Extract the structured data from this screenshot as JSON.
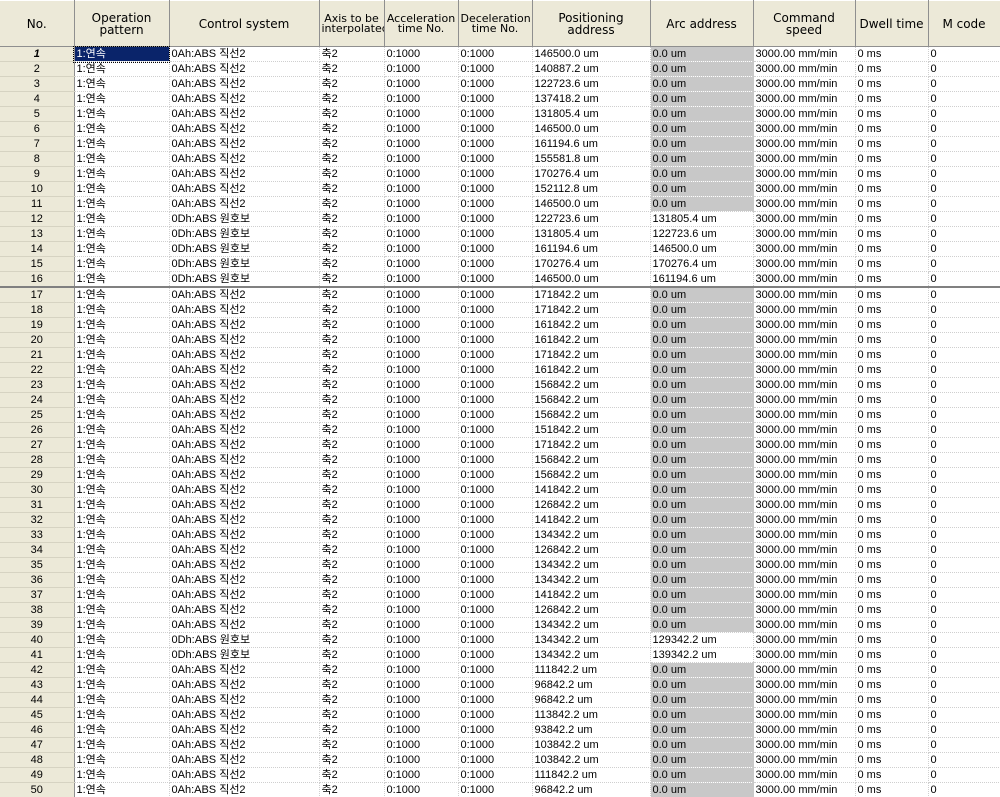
{
  "headers": {
    "no": "No.",
    "pattern": "Operation pattern",
    "control": "Control system",
    "axis": "Axis to be interpolated",
    "accel": "Acceleration time No.",
    "decel": "Deceleration time No.",
    "pos": "Positioning address",
    "arc": "Arc address",
    "speed": "Command speed",
    "dwell": "Dwell time",
    "mcode": "M code"
  },
  "rows": [
    {
      "no": "1",
      "pattern": "1:연속",
      "control": "0Ah:ABS 직선2",
      "axis": "축2",
      "accel": "0:1000",
      "decel": "0:1000",
      "pos": "146500.0 um",
      "arc": "0.0 um",
      "speed": "3000.00 mm/min",
      "dwell": "0 ms",
      "mcode": "0"
    },
    {
      "no": "2",
      "pattern": "1:연속",
      "control": "0Ah:ABS 직선2",
      "axis": "축2",
      "accel": "0:1000",
      "decel": "0:1000",
      "pos": "140887.2 um",
      "arc": "0.0 um",
      "speed": "3000.00 mm/min",
      "dwell": "0 ms",
      "mcode": "0"
    },
    {
      "no": "3",
      "pattern": "1:연속",
      "control": "0Ah:ABS 직선2",
      "axis": "축2",
      "accel": "0:1000",
      "decel": "0:1000",
      "pos": "122723.6 um",
      "arc": "0.0 um",
      "speed": "3000.00 mm/min",
      "dwell": "0 ms",
      "mcode": "0"
    },
    {
      "no": "4",
      "pattern": "1:연속",
      "control": "0Ah:ABS 직선2",
      "axis": "축2",
      "accel": "0:1000",
      "decel": "0:1000",
      "pos": "137418.2 um",
      "arc": "0.0 um",
      "speed": "3000.00 mm/min",
      "dwell": "0 ms",
      "mcode": "0"
    },
    {
      "no": "5",
      "pattern": "1:연속",
      "control": "0Ah:ABS 직선2",
      "axis": "축2",
      "accel": "0:1000",
      "decel": "0:1000",
      "pos": "131805.4 um",
      "arc": "0.0 um",
      "speed": "3000.00 mm/min",
      "dwell": "0 ms",
      "mcode": "0"
    },
    {
      "no": "6",
      "pattern": "1:연속",
      "control": "0Ah:ABS 직선2",
      "axis": "축2",
      "accel": "0:1000",
      "decel": "0:1000",
      "pos": "146500.0 um",
      "arc": "0.0 um",
      "speed": "3000.00 mm/min",
      "dwell": "0 ms",
      "mcode": "0"
    },
    {
      "no": "7",
      "pattern": "1:연속",
      "control": "0Ah:ABS 직선2",
      "axis": "축2",
      "accel": "0:1000",
      "decel": "0:1000",
      "pos": "161194.6 um",
      "arc": "0.0 um",
      "speed": "3000.00 mm/min",
      "dwell": "0 ms",
      "mcode": "0"
    },
    {
      "no": "8",
      "pattern": "1:연속",
      "control": "0Ah:ABS 직선2",
      "axis": "축2",
      "accel": "0:1000",
      "decel": "0:1000",
      "pos": "155581.8 um",
      "arc": "0.0 um",
      "speed": "3000.00 mm/min",
      "dwell": "0 ms",
      "mcode": "0"
    },
    {
      "no": "9",
      "pattern": "1:연속",
      "control": "0Ah:ABS 직선2",
      "axis": "축2",
      "accel": "0:1000",
      "decel": "0:1000",
      "pos": "170276.4 um",
      "arc": "0.0 um",
      "speed": "3000.00 mm/min",
      "dwell": "0 ms",
      "mcode": "0"
    },
    {
      "no": "10",
      "pattern": "1:연속",
      "control": "0Ah:ABS 직선2",
      "axis": "축2",
      "accel": "0:1000",
      "decel": "0:1000",
      "pos": "152112.8 um",
      "arc": "0.0 um",
      "speed": "3000.00 mm/min",
      "dwell": "0 ms",
      "mcode": "0"
    },
    {
      "no": "11",
      "pattern": "1:연속",
      "control": "0Ah:ABS 직선2",
      "axis": "축2",
      "accel": "0:1000",
      "decel": "0:1000",
      "pos": "146500.0 um",
      "arc": "0.0 um",
      "speed": "3000.00 mm/min",
      "dwell": "0 ms",
      "mcode": "0"
    },
    {
      "no": "12",
      "pattern": "1:연속",
      "control": "0Dh:ABS 원호보",
      "axis": "축2",
      "accel": "0:1000",
      "decel": "0:1000",
      "pos": "122723.6 um",
      "arc": "131805.4 um",
      "speed": "3000.00 mm/min",
      "dwell": "0 ms",
      "mcode": "0"
    },
    {
      "no": "13",
      "pattern": "1:연속",
      "control": "0Dh:ABS 원호보",
      "axis": "축2",
      "accel": "0:1000",
      "decel": "0:1000",
      "pos": "131805.4 um",
      "arc": "122723.6 um",
      "speed": "3000.00 mm/min",
      "dwell": "0 ms",
      "mcode": "0"
    },
    {
      "no": "14",
      "pattern": "1:연속",
      "control": "0Dh:ABS 원호보",
      "axis": "축2",
      "accel": "0:1000",
      "decel": "0:1000",
      "pos": "161194.6 um",
      "arc": "146500.0 um",
      "speed": "3000.00 mm/min",
      "dwell": "0 ms",
      "mcode": "0"
    },
    {
      "no": "15",
      "pattern": "1:연속",
      "control": "0Dh:ABS 원호보",
      "axis": "축2",
      "accel": "0:1000",
      "decel": "0:1000",
      "pos": "170276.4 um",
      "arc": "170276.4 um",
      "speed": "3000.00 mm/min",
      "dwell": "0 ms",
      "mcode": "0"
    },
    {
      "no": "16",
      "pattern": "1:연속",
      "control": "0Dh:ABS 원호보",
      "axis": "축2",
      "accel": "0:1000",
      "decel": "0:1000",
      "pos": "146500.0 um",
      "arc": "161194.6 um",
      "speed": "3000.00 mm/min",
      "dwell": "0 ms",
      "mcode": "0"
    },
    {
      "no": "17",
      "pattern": "1:연속",
      "control": "0Ah:ABS 직선2",
      "axis": "축2",
      "accel": "0:1000",
      "decel": "0:1000",
      "pos": "171842.2 um",
      "arc": "0.0 um",
      "speed": "3000.00 mm/min",
      "dwell": "0 ms",
      "mcode": "0"
    },
    {
      "no": "18",
      "pattern": "1:연속",
      "control": "0Ah:ABS 직선2",
      "axis": "축2",
      "accel": "0:1000",
      "decel": "0:1000",
      "pos": "171842.2 um",
      "arc": "0.0 um",
      "speed": "3000.00 mm/min",
      "dwell": "0 ms",
      "mcode": "0"
    },
    {
      "no": "19",
      "pattern": "1:연속",
      "control": "0Ah:ABS 직선2",
      "axis": "축2",
      "accel": "0:1000",
      "decel": "0:1000",
      "pos": "161842.2 um",
      "arc": "0.0 um",
      "speed": "3000.00 mm/min",
      "dwell": "0 ms",
      "mcode": "0"
    },
    {
      "no": "20",
      "pattern": "1:연속",
      "control": "0Ah:ABS 직선2",
      "axis": "축2",
      "accel": "0:1000",
      "decel": "0:1000",
      "pos": "161842.2 um",
      "arc": "0.0 um",
      "speed": "3000.00 mm/min",
      "dwell": "0 ms",
      "mcode": "0"
    },
    {
      "no": "21",
      "pattern": "1:연속",
      "control": "0Ah:ABS 직선2",
      "axis": "축2",
      "accel": "0:1000",
      "decel": "0:1000",
      "pos": "171842.2 um",
      "arc": "0.0 um",
      "speed": "3000.00 mm/min",
      "dwell": "0 ms",
      "mcode": "0"
    },
    {
      "no": "22",
      "pattern": "1:연속",
      "control": "0Ah:ABS 직선2",
      "axis": "축2",
      "accel": "0:1000",
      "decel": "0:1000",
      "pos": "161842.2 um",
      "arc": "0.0 um",
      "speed": "3000.00 mm/min",
      "dwell": "0 ms",
      "mcode": "0"
    },
    {
      "no": "23",
      "pattern": "1:연속",
      "control": "0Ah:ABS 직선2",
      "axis": "축2",
      "accel": "0:1000",
      "decel": "0:1000",
      "pos": "156842.2 um",
      "arc": "0.0 um",
      "speed": "3000.00 mm/min",
      "dwell": "0 ms",
      "mcode": "0"
    },
    {
      "no": "24",
      "pattern": "1:연속",
      "control": "0Ah:ABS 직선2",
      "axis": "축2",
      "accel": "0:1000",
      "decel": "0:1000",
      "pos": "156842.2 um",
      "arc": "0.0 um",
      "speed": "3000.00 mm/min",
      "dwell": "0 ms",
      "mcode": "0"
    },
    {
      "no": "25",
      "pattern": "1:연속",
      "control": "0Ah:ABS 직선2",
      "axis": "축2",
      "accel": "0:1000",
      "decel": "0:1000",
      "pos": "156842.2 um",
      "arc": "0.0 um",
      "speed": "3000.00 mm/min",
      "dwell": "0 ms",
      "mcode": "0"
    },
    {
      "no": "26",
      "pattern": "1:연속",
      "control": "0Ah:ABS 직선2",
      "axis": "축2",
      "accel": "0:1000",
      "decel": "0:1000",
      "pos": "151842.2 um",
      "arc": "0.0 um",
      "speed": "3000.00 mm/min",
      "dwell": "0 ms",
      "mcode": "0"
    },
    {
      "no": "27",
      "pattern": "1:연속",
      "control": "0Ah:ABS 직선2",
      "axis": "축2",
      "accel": "0:1000",
      "decel": "0:1000",
      "pos": "171842.2 um",
      "arc": "0.0 um",
      "speed": "3000.00 mm/min",
      "dwell": "0 ms",
      "mcode": "0"
    },
    {
      "no": "28",
      "pattern": "1:연속",
      "control": "0Ah:ABS 직선2",
      "axis": "축2",
      "accel": "0:1000",
      "decel": "0:1000",
      "pos": "156842.2 um",
      "arc": "0.0 um",
      "speed": "3000.00 mm/min",
      "dwell": "0 ms",
      "mcode": "0"
    },
    {
      "no": "29",
      "pattern": "1:연속",
      "control": "0Ah:ABS 직선2",
      "axis": "축2",
      "accel": "0:1000",
      "decel": "0:1000",
      "pos": "156842.2 um",
      "arc": "0.0 um",
      "speed": "3000.00 mm/min",
      "dwell": "0 ms",
      "mcode": "0"
    },
    {
      "no": "30",
      "pattern": "1:연속",
      "control": "0Ah:ABS 직선2",
      "axis": "축2",
      "accel": "0:1000",
      "decel": "0:1000",
      "pos": "141842.2 um",
      "arc": "0.0 um",
      "speed": "3000.00 mm/min",
      "dwell": "0 ms",
      "mcode": "0"
    },
    {
      "no": "31",
      "pattern": "1:연속",
      "control": "0Ah:ABS 직선2",
      "axis": "축2",
      "accel": "0:1000",
      "decel": "0:1000",
      "pos": "126842.2 um",
      "arc": "0.0 um",
      "speed": "3000.00 mm/min",
      "dwell": "0 ms",
      "mcode": "0"
    },
    {
      "no": "32",
      "pattern": "1:연속",
      "control": "0Ah:ABS 직선2",
      "axis": "축2",
      "accel": "0:1000",
      "decel": "0:1000",
      "pos": "141842.2 um",
      "arc": "0.0 um",
      "speed": "3000.00 mm/min",
      "dwell": "0 ms",
      "mcode": "0"
    },
    {
      "no": "33",
      "pattern": "1:연속",
      "control": "0Ah:ABS 직선2",
      "axis": "축2",
      "accel": "0:1000",
      "decel": "0:1000",
      "pos": "134342.2 um",
      "arc": "0.0 um",
      "speed": "3000.00 mm/min",
      "dwell": "0 ms",
      "mcode": "0"
    },
    {
      "no": "34",
      "pattern": "1:연속",
      "control": "0Ah:ABS 직선2",
      "axis": "축2",
      "accel": "0:1000",
      "decel": "0:1000",
      "pos": "126842.2 um",
      "arc": "0.0 um",
      "speed": "3000.00 mm/min",
      "dwell": "0 ms",
      "mcode": "0"
    },
    {
      "no": "35",
      "pattern": "1:연속",
      "control": "0Ah:ABS 직선2",
      "axis": "축2",
      "accel": "0:1000",
      "decel": "0:1000",
      "pos": "134342.2 um",
      "arc": "0.0 um",
      "speed": "3000.00 mm/min",
      "dwell": "0 ms",
      "mcode": "0"
    },
    {
      "no": "36",
      "pattern": "1:연속",
      "control": "0Ah:ABS 직선2",
      "axis": "축2",
      "accel": "0:1000",
      "decel": "0:1000",
      "pos": "134342.2 um",
      "arc": "0.0 um",
      "speed": "3000.00 mm/min",
      "dwell": "0 ms",
      "mcode": "0"
    },
    {
      "no": "37",
      "pattern": "1:연속",
      "control": "0Ah:ABS 직선2",
      "axis": "축2",
      "accel": "0:1000",
      "decel": "0:1000",
      "pos": "141842.2 um",
      "arc": "0.0 um",
      "speed": "3000.00 mm/min",
      "dwell": "0 ms",
      "mcode": "0"
    },
    {
      "no": "38",
      "pattern": "1:연속",
      "control": "0Ah:ABS 직선2",
      "axis": "축2",
      "accel": "0:1000",
      "decel": "0:1000",
      "pos": "126842.2 um",
      "arc": "0.0 um",
      "speed": "3000.00 mm/min",
      "dwell": "0 ms",
      "mcode": "0"
    },
    {
      "no": "39",
      "pattern": "1:연속",
      "control": "0Ah:ABS 직선2",
      "axis": "축2",
      "accel": "0:1000",
      "decel": "0:1000",
      "pos": "134342.2 um",
      "arc": "0.0 um",
      "speed": "3000.00 mm/min",
      "dwell": "0 ms",
      "mcode": "0"
    },
    {
      "no": "40",
      "pattern": "1:연속",
      "control": "0Dh:ABS 원호보",
      "axis": "축2",
      "accel": "0:1000",
      "decel": "0:1000",
      "pos": "134342.2 um",
      "arc": "129342.2 um",
      "speed": "3000.00 mm/min",
      "dwell": "0 ms",
      "mcode": "0"
    },
    {
      "no": "41",
      "pattern": "1:연속",
      "control": "0Dh:ABS 원호보",
      "axis": "축2",
      "accel": "0:1000",
      "decel": "0:1000",
      "pos": "134342.2 um",
      "arc": "139342.2 um",
      "speed": "3000.00 mm/min",
      "dwell": "0 ms",
      "mcode": "0"
    },
    {
      "no": "42",
      "pattern": "1:연속",
      "control": "0Ah:ABS 직선2",
      "axis": "축2",
      "accel": "0:1000",
      "decel": "0:1000",
      "pos": "111842.2 um",
      "arc": "0.0 um",
      "speed": "3000.00 mm/min",
      "dwell": "0 ms",
      "mcode": "0"
    },
    {
      "no": "43",
      "pattern": "1:연속",
      "control": "0Ah:ABS 직선2",
      "axis": "축2",
      "accel": "0:1000",
      "decel": "0:1000",
      "pos": "96842.2 um",
      "arc": "0.0 um",
      "speed": "3000.00 mm/min",
      "dwell": "0 ms",
      "mcode": "0"
    },
    {
      "no": "44",
      "pattern": "1:연속",
      "control": "0Ah:ABS 직선2",
      "axis": "축2",
      "accel": "0:1000",
      "decel": "0:1000",
      "pos": "96842.2 um",
      "arc": "0.0 um",
      "speed": "3000.00 mm/min",
      "dwell": "0 ms",
      "mcode": "0"
    },
    {
      "no": "45",
      "pattern": "1:연속",
      "control": "0Ah:ABS 직선2",
      "axis": "축2",
      "accel": "0:1000",
      "decel": "0:1000",
      "pos": "113842.2 um",
      "arc": "0.0 um",
      "speed": "3000.00 mm/min",
      "dwell": "0 ms",
      "mcode": "0"
    },
    {
      "no": "46",
      "pattern": "1:연속",
      "control": "0Ah:ABS 직선2",
      "axis": "축2",
      "accel": "0:1000",
      "decel": "0:1000",
      "pos": "93842.2 um",
      "arc": "0.0 um",
      "speed": "3000.00 mm/min",
      "dwell": "0 ms",
      "mcode": "0"
    },
    {
      "no": "47",
      "pattern": "1:연속",
      "control": "0Ah:ABS 직선2",
      "axis": "축2",
      "accel": "0:1000",
      "decel": "0:1000",
      "pos": "103842.2 um",
      "arc": "0.0 um",
      "speed": "3000.00 mm/min",
      "dwell": "0 ms",
      "mcode": "0"
    },
    {
      "no": "48",
      "pattern": "1:연속",
      "control": "0Ah:ABS 직선2",
      "axis": "축2",
      "accel": "0:1000",
      "decel": "0:1000",
      "pos": "103842.2 um",
      "arc": "0.0 um",
      "speed": "3000.00 mm/min",
      "dwell": "0 ms",
      "mcode": "0"
    },
    {
      "no": "49",
      "pattern": "1:연속",
      "control": "0Ah:ABS 직선2",
      "axis": "축2",
      "accel": "0:1000",
      "decel": "0:1000",
      "pos": "111842.2 um",
      "arc": "0.0 um",
      "speed": "3000.00 mm/min",
      "dwell": "0 ms",
      "mcode": "0"
    },
    {
      "no": "50",
      "pattern": "1:연속",
      "control": "0Ah:ABS 직선2",
      "axis": "축2",
      "accel": "0:1000",
      "decel": "0:1000",
      "pos": "96842.2 um",
      "arc": "0.0 um",
      "speed": "3000.00 mm/min",
      "dwell": "0 ms",
      "mcode": "0"
    }
  ]
}
